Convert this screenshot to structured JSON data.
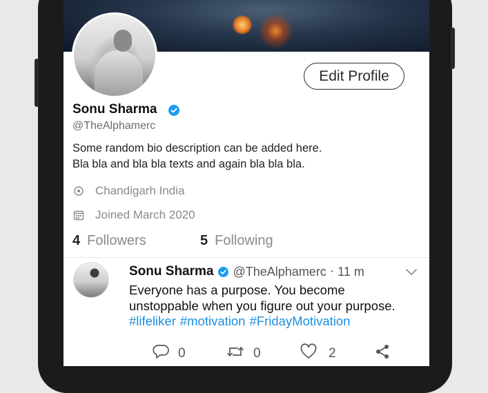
{
  "profile": {
    "name": "Sonu Sharma",
    "handle": "@TheAlphamerc",
    "bio": "Some random bio description can be added here.\nBla bla and bla bla texts and again bla bla bla.",
    "location": "Chandigarh India",
    "joined": "Joined March 2020",
    "edit_label": "Edit Profile",
    "followers_count": "4",
    "followers_label": "Followers",
    "following_count": "5",
    "following_label": "Following"
  },
  "tweet": {
    "name": "Sonu Sharma",
    "handle": "@TheAlphamerc",
    "separator": "·",
    "time": "11 m",
    "text": "Everyone has a purpose. You become\nunstoppable when you figure out your purpose.",
    "hashtags": [
      "#lifeliker",
      "#motivation",
      "#FridayMotivation"
    ],
    "reply_count": "0",
    "retweet_count": "0",
    "like_count": "2"
  },
  "colors": {
    "accent": "#1d8fe0",
    "verified": "#1d9bf0",
    "text_primary": "#111111",
    "text_secondary": "#8a8a8a"
  },
  "icons": [
    "verified-badge-icon",
    "location-pin-icon",
    "calendar-icon",
    "chevron-down-icon",
    "reply-icon",
    "retweet-icon",
    "like-icon",
    "share-icon"
  ]
}
